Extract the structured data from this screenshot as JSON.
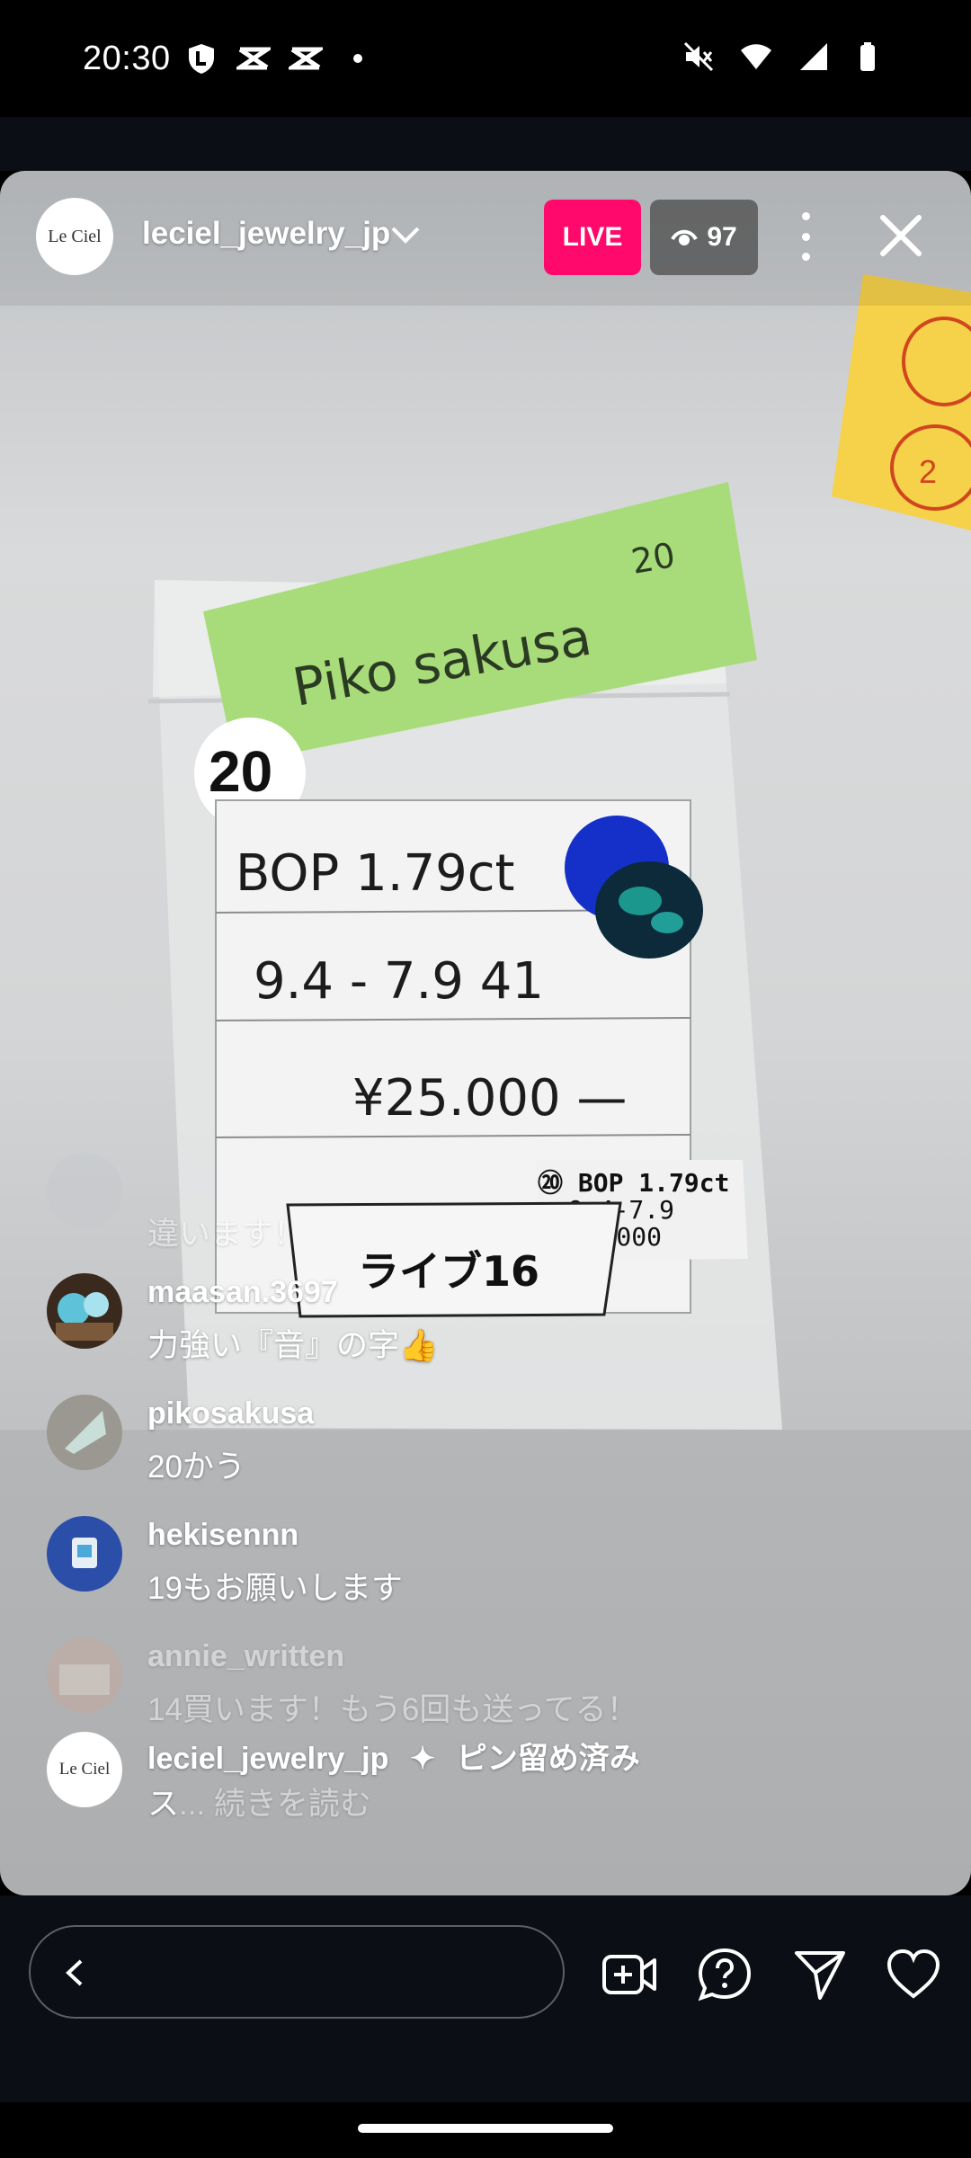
{
  "status_bar": {
    "time": "20:30",
    "left_icons": [
      "shield-l-icon",
      "capcut-icon",
      "capcut-icon",
      "dot-icon"
    ],
    "right_icons": [
      "mute-icon",
      "wifi-icon",
      "signal-icon",
      "battery-icon"
    ]
  },
  "live_header": {
    "host_username": "leciel_jewelry_jp",
    "host_avatar_text": "Le Ciel",
    "live_badge": "LIVE",
    "viewer_count": "97",
    "live_color": "#ff0a6c"
  },
  "scene_text": {
    "sticky_note": "Piko sakusa",
    "sticky_number": "20",
    "circle_number": "20",
    "card_line1": "BOP 1.79ct",
    "card_line2": "9.4 - 7.9   41",
    "card_line3": "¥25.000 —",
    "label_line1": "⑳ BOP 1.79ct",
    "label_line2": "9.4-7.9",
    "label_line3": "¥25.000",
    "live_tag": "ライブ16"
  },
  "comments": [
    {
      "username": "",
      "text": "違います！",
      "faded": true
    },
    {
      "username": "maasan.3697",
      "text": "力強い『音』の字👍"
    },
    {
      "username": "pikosakusa",
      "text": "20かう"
    },
    {
      "username": "hekisennn",
      "text": "19もお願いします"
    },
    {
      "username": "annie_written",
      "text": "14買います！もう6回も送ってる！",
      "faded": true
    },
    {
      "username": "leciel_jewelry_jp",
      "pinned_label": "ピン留め済み",
      "text": "ス",
      "read_more": "... 続きを読む"
    }
  ],
  "bottom_bar": {
    "input_placeholder": "",
    "icons": [
      "add-video-icon",
      "question-icon",
      "send-icon",
      "heart-icon"
    ]
  }
}
